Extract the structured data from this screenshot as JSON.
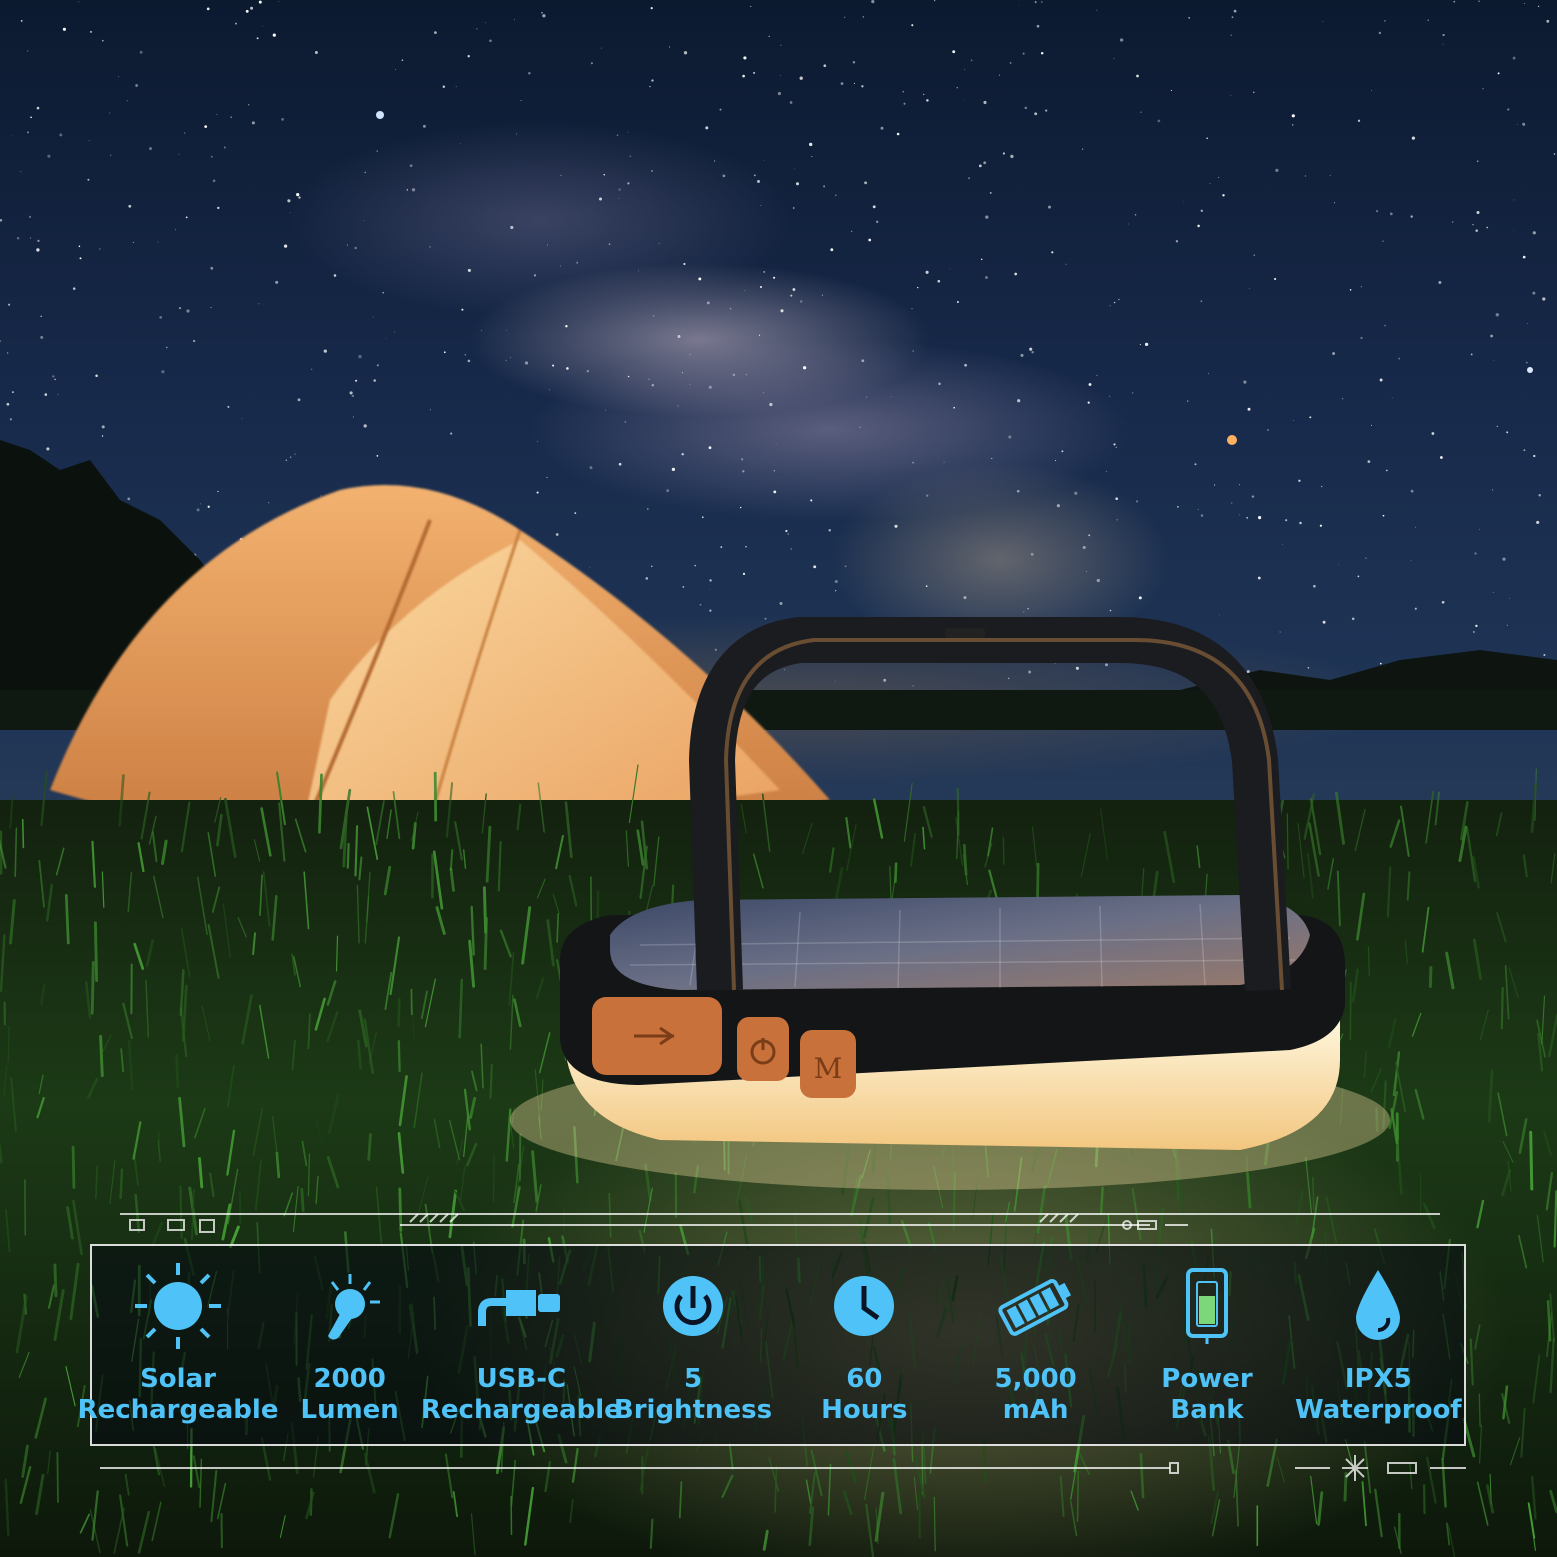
{
  "scene": {
    "description_icon": "camping-lantern-photo"
  },
  "product": {
    "buttons": {
      "usb_icon": "usb-icon",
      "power_icon": "power-icon",
      "mode_label": "M"
    }
  },
  "features": [
    {
      "icon": "sun-icon",
      "line1": "Solar",
      "line2": "Rechargeable"
    },
    {
      "icon": "bulb-icon",
      "line1": "2000",
      "line2": "Lumen"
    },
    {
      "icon": "usb-c-plug-icon",
      "line1": "USB-C",
      "line2": "Rechargeable"
    },
    {
      "icon": "power-icon",
      "line1": "5",
      "line2": "Brightness"
    },
    {
      "icon": "clock-icon",
      "line1": "60",
      "line2": "Hours"
    },
    {
      "icon": "battery-icon",
      "line1": "5,000",
      "line2": "mAh"
    },
    {
      "icon": "phone-battery-icon",
      "line1": "Power",
      "line2": "Bank"
    },
    {
      "icon": "water-drop-icon",
      "line1": "IPX5",
      "line2": "Waterproof"
    }
  ],
  "colors": {
    "accent": "#4fc3f7",
    "button_orange": "#c8713a",
    "tent": "#e9a060"
  }
}
